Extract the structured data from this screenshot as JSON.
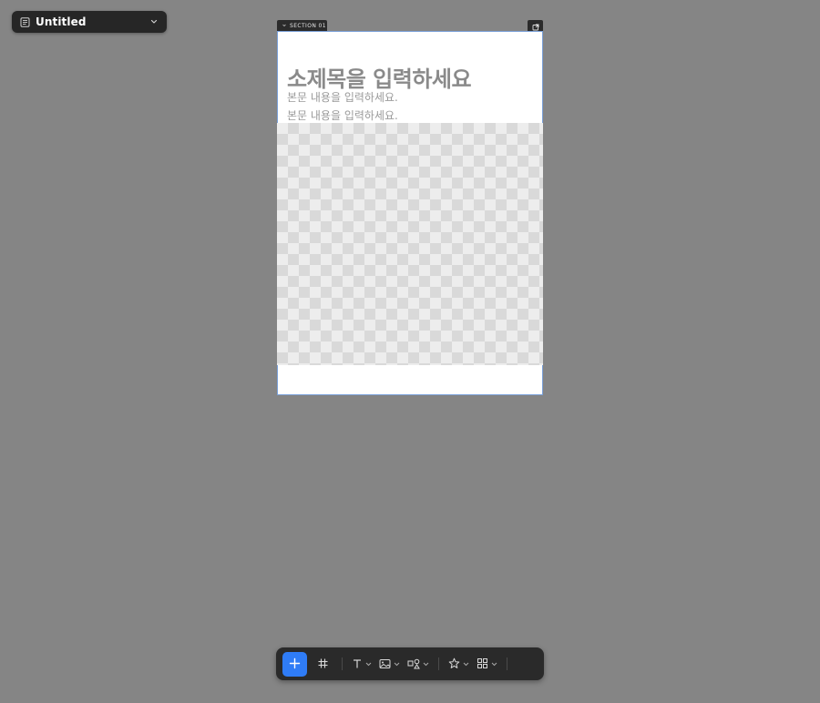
{
  "document": {
    "title": "Untitled",
    "icon": "document-icon",
    "menu_icon": "chevron-down-icon"
  },
  "section": {
    "label": "SECTION 01",
    "collapse_icon": "chevron-down-icon",
    "action_icon": "external-link-icon",
    "subtitle": "소제목을 입력하세요",
    "body_lines": [
      "본문 내용을 입력하세요.",
      "본문 내용을 입력하세요."
    ],
    "image_placeholder": "transparent-checkerboard"
  },
  "toolbar": {
    "items": [
      {
        "name": "add",
        "icon": "plus-icon",
        "accent": "#2f7cf6"
      },
      {
        "name": "frame",
        "icon": "hash-icon"
      },
      {
        "name": "text",
        "icon": "text-icon",
        "dropdown": true
      },
      {
        "name": "image",
        "icon": "image-icon",
        "dropdown": true
      },
      {
        "name": "shapes",
        "icon": "shapes-icon",
        "dropdown": true
      },
      {
        "name": "favorites",
        "icon": "star-icon",
        "dropdown": true
      },
      {
        "name": "components",
        "icon": "grid-icon",
        "dropdown": true
      }
    ]
  },
  "colors": {
    "canvas": "#858585",
    "toolbar": "#2a2a2a",
    "accent": "#2f7cf6",
    "frame_border": "#7aa0d8"
  }
}
